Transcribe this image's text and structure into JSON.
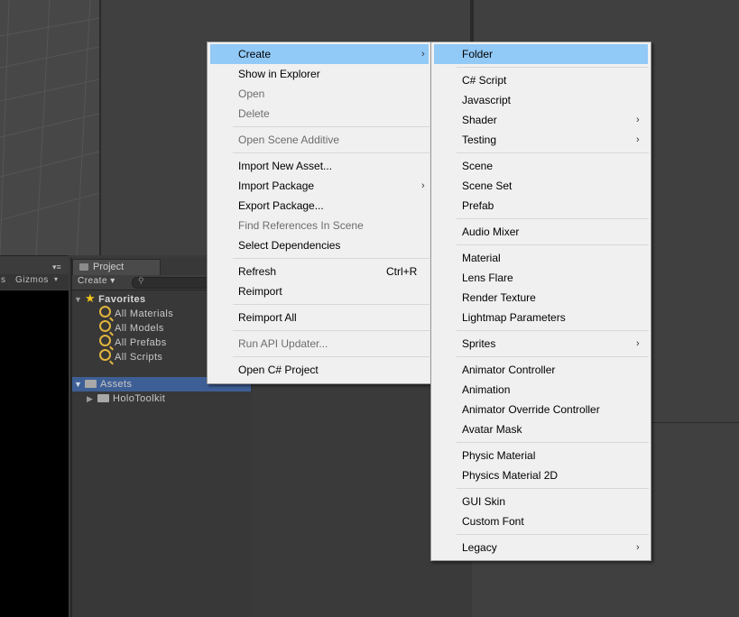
{
  "project_panel": {
    "tab_label": "Project",
    "create_label": "Create ▾",
    "search_placeholder": "",
    "favorites": {
      "title": "Favorites",
      "items": [
        "All Materials",
        "All Models",
        "All Prefabs",
        "All Scripts"
      ]
    },
    "assets": {
      "title": "Assets",
      "children": [
        "HoloToolkit"
      ]
    }
  },
  "game_view": {
    "gizmos_label": "Gizmos",
    "partial_label": "s"
  },
  "context_menu": {
    "items": [
      {
        "label": "Create",
        "enabled": true,
        "highlighted": true,
        "submenu": true
      },
      {
        "label": "Show in Explorer",
        "enabled": true
      },
      {
        "label": "Open",
        "enabled": false
      },
      {
        "label": "Delete",
        "enabled": false
      },
      {
        "label": "Open Scene Additive",
        "enabled": false
      },
      {
        "label": "Import New Asset...",
        "enabled": true
      },
      {
        "label": "Import Package",
        "enabled": true,
        "submenu": true
      },
      {
        "label": "Export Package...",
        "enabled": true
      },
      {
        "label": "Find References In Scene",
        "enabled": false
      },
      {
        "label": "Select Dependencies",
        "enabled": true
      },
      {
        "label": "Refresh",
        "enabled": true,
        "shortcut": "Ctrl+R"
      },
      {
        "label": "Reimport",
        "enabled": true
      },
      {
        "label": "Reimport All",
        "enabled": true
      },
      {
        "label": "Run API Updater...",
        "enabled": false
      },
      {
        "label": "Open C# Project",
        "enabled": true
      }
    ]
  },
  "create_submenu": {
    "items": [
      {
        "label": "Folder",
        "highlighted": true
      },
      {
        "label": "C# Script"
      },
      {
        "label": "Javascript"
      },
      {
        "label": "Shader",
        "submenu": true
      },
      {
        "label": "Testing",
        "submenu": true
      },
      {
        "label": "Scene"
      },
      {
        "label": "Scene Set"
      },
      {
        "label": "Prefab"
      },
      {
        "label": "Audio Mixer"
      },
      {
        "label": "Material"
      },
      {
        "label": "Lens Flare"
      },
      {
        "label": "Render Texture"
      },
      {
        "label": "Lightmap Parameters"
      },
      {
        "label": "Sprites",
        "submenu": true
      },
      {
        "label": "Animator Controller"
      },
      {
        "label": "Animation"
      },
      {
        "label": "Animator Override Controller"
      },
      {
        "label": "Avatar Mask"
      },
      {
        "label": "Physic Material"
      },
      {
        "label": "Physics Material 2D"
      },
      {
        "label": "GUI Skin"
      },
      {
        "label": "Custom Font"
      },
      {
        "label": "Legacy",
        "submenu": true
      }
    ]
  },
  "colors": {
    "highlight": "#91c9f7",
    "menu_bg": "#f0f0f0",
    "disabled_text": "#6d6d6d",
    "selection_row": "#3e5f96"
  }
}
